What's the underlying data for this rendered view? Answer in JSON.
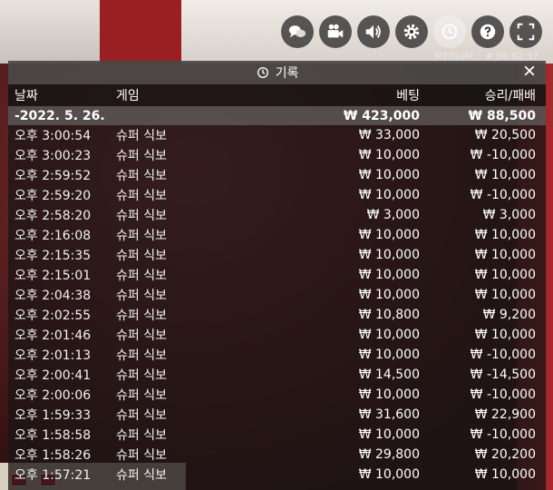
{
  "controls": [
    {
      "name": "chat-icon"
    },
    {
      "name": "video-camera-icon"
    },
    {
      "name": "volume-icon"
    },
    {
      "name": "gear-icon"
    },
    {
      "name": "history-icon",
      "active": true
    },
    {
      "name": "help-icon"
    },
    {
      "name": "fullscreen-icon"
    }
  ],
  "meta": {
    "limit": "MEDIUM",
    "session": "# 06:02:37"
  },
  "panel": {
    "title": "기록",
    "columns": {
      "date": "날짜",
      "game": "게임",
      "bet": "베팅",
      "win": "승리/패배"
    },
    "date_group": {
      "date": "-2022. 5. 26.",
      "bet": "₩ 423,000",
      "win": "₩ 88,500"
    },
    "rows": [
      {
        "time": "오후 3:00:54",
        "game": "슈퍼 식보",
        "bet": "₩ 33,000",
        "win": "₩ 20,500"
      },
      {
        "time": "오후 3:00:23",
        "game": "슈퍼 식보",
        "bet": "₩ 10,000",
        "win": "₩ -10,000"
      },
      {
        "time": "오후 2:59:52",
        "game": "슈퍼 식보",
        "bet": "₩ 10,000",
        "win": "₩ 10,000"
      },
      {
        "time": "오후 2:59:20",
        "game": "슈퍼 식보",
        "bet": "₩ 10,000",
        "win": "₩ -10,000"
      },
      {
        "time": "오후 2:58:20",
        "game": "슈퍼 식보",
        "bet": "₩ 3,000",
        "win": "₩ 3,000"
      },
      {
        "time": "오후 2:16:08",
        "game": "슈퍼 식보",
        "bet": "₩ 10,000",
        "win": "₩ 10,000"
      },
      {
        "time": "오후 2:15:35",
        "game": "슈퍼 식보",
        "bet": "₩ 10,000",
        "win": "₩ 10,000"
      },
      {
        "time": "오후 2:15:01",
        "game": "슈퍼 식보",
        "bet": "₩ 10,000",
        "win": "₩ 10,000"
      },
      {
        "time": "오후 2:04:38",
        "game": "슈퍼 식보",
        "bet": "₩ 10,000",
        "win": "₩ 10,000"
      },
      {
        "time": "오후 2:02:55",
        "game": "슈퍼 식보",
        "bet": "₩ 10,800",
        "win": "₩ 9,200"
      },
      {
        "time": "오후 2:01:46",
        "game": "슈퍼 식보",
        "bet": "₩ 10,000",
        "win": "₩ 10,000"
      },
      {
        "time": "오후 2:01:13",
        "game": "슈퍼 식보",
        "bet": "₩ 10,000",
        "win": "₩ -10,000"
      },
      {
        "time": "오후 2:00:41",
        "game": "슈퍼 식보",
        "bet": "₩ 14,500",
        "win": "₩ -14,500"
      },
      {
        "time": "오후 2:00:06",
        "game": "슈퍼 식보",
        "bet": "₩ 10,000",
        "win": "₩ -10,000"
      },
      {
        "time": "오후 1:59:33",
        "game": "슈퍼 식보",
        "bet": "₩ 31,600",
        "win": "₩ 22,900"
      },
      {
        "time": "오후 1:58:58",
        "game": "슈퍼 식보",
        "bet": "₩ 10,000",
        "win": "₩ -10,000"
      },
      {
        "time": "오후 1:58:26",
        "game": "슈퍼 식보",
        "bet": "₩ 29,800",
        "win": "₩ 20,200"
      },
      {
        "time": "오후 1:57:21",
        "game": "슈퍼 식보",
        "bet": "₩ 10,000",
        "win": "₩ 10,000"
      }
    ]
  }
}
